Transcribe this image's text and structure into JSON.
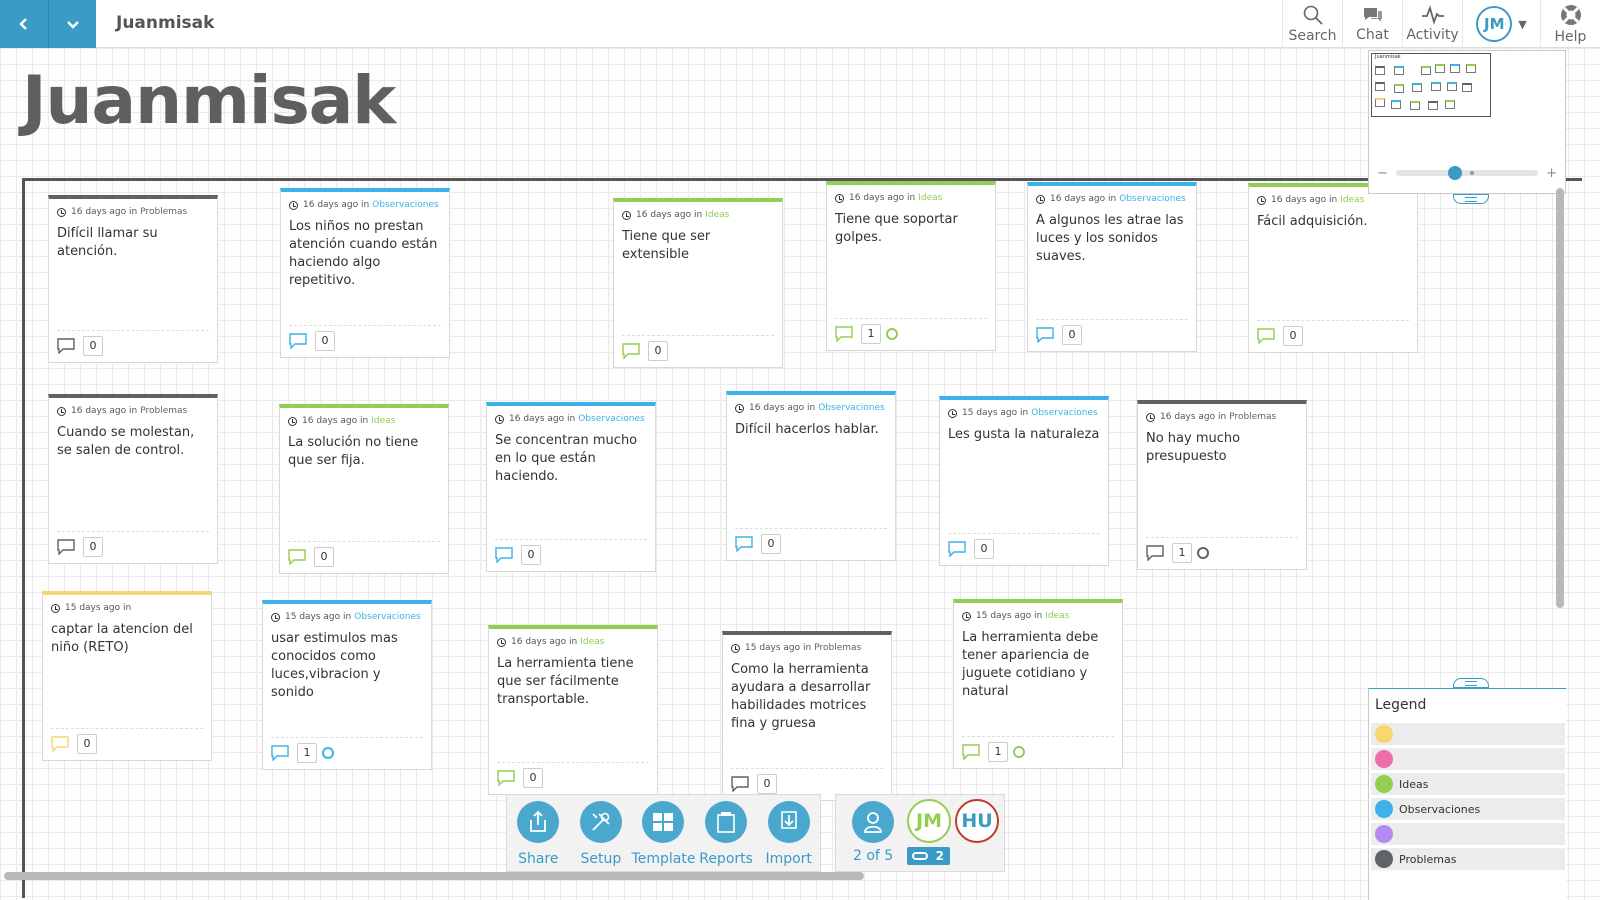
{
  "app": {
    "title": "Juanmisak"
  },
  "board": {
    "title": "Juanmisak"
  },
  "header": {
    "actions": [
      {
        "id": "search",
        "label": "Search",
        "icon": "search-icon"
      },
      {
        "id": "chat",
        "label": "Chat",
        "icon": "chat-icon"
      },
      {
        "id": "activity",
        "label": "Activity",
        "icon": "activity-icon"
      }
    ],
    "user_initials": "JM",
    "help_label": "Help"
  },
  "colors": {
    "accent": "#3a9cc4",
    "ideas": "#93cd52",
    "observaciones": "#3db2e8",
    "problemas": "#5f6368",
    "yellow": "#f5d76e",
    "pink": "#ef6ea8",
    "purple": "#b58af0"
  },
  "cards": [
    {
      "meta": "16 days ago",
      "in": "in",
      "category": "Problemas",
      "text": "Difícil llamar su atención.",
      "comments": "0",
      "color": "problemas"
    },
    {
      "meta": "16 days ago",
      "in": "in",
      "category": "Observaciones",
      "text": "Los niños no prestan atención cuando están haciendo algo repetitivo.",
      "comments": "0",
      "color": "observaciones"
    },
    {
      "meta": "16 days ago",
      "in": "in",
      "category": "Ideas",
      "text": "Tiene que ser extensible",
      "comments": "0",
      "color": "ideas"
    },
    {
      "meta": "16 days ago",
      "in": "in",
      "category": "Ideas",
      "text": "Tiene que soportar golpes.",
      "comments": "1",
      "color": "ideas",
      "vote": true
    },
    {
      "meta": "16 days ago",
      "in": "in",
      "category": "Observaciones",
      "text": "A algunos les atrae las luces y los sonidos suaves.",
      "comments": "0",
      "color": "observaciones"
    },
    {
      "meta": "16 days ago",
      "in": "in",
      "category": "Ideas",
      "text": "Fácil adquisición.",
      "comments": "0",
      "color": "ideas"
    },
    {
      "meta": "16 days ago",
      "in": "in",
      "category": "Problemas",
      "text": "Cuando se molestan, se salen de control.",
      "comments": "0",
      "color": "problemas"
    },
    {
      "meta": "16 days ago",
      "in": "in",
      "category": "Ideas",
      "text": "La solución no tiene que ser fija.",
      "comments": "0",
      "color": "ideas"
    },
    {
      "meta": "16 days ago",
      "in": "in",
      "category": "Observaciones",
      "text": "Se concentran mucho en lo que están haciendo.",
      "comments": "0",
      "color": "observaciones"
    },
    {
      "meta": "16 days ago",
      "in": "in",
      "category": "Observaciones",
      "text": "Difícil hacerlos hablar.",
      "comments": "0",
      "color": "observaciones"
    },
    {
      "meta": "15 days ago",
      "in": "in",
      "category": "Observaciones",
      "text": "Les gusta la naturaleza",
      "comments": "0",
      "color": "observaciones"
    },
    {
      "meta": "16 days ago",
      "in": "in",
      "category": "Problemas",
      "text": "No hay mucho presupuesto",
      "comments": "1",
      "color": "problemas",
      "vote": true
    },
    {
      "meta": "15 days ago",
      "in": "in",
      "category": "",
      "text": "captar la atencion del niño (RETO)",
      "comments": "0",
      "color": "yellow"
    },
    {
      "meta": "15 days ago",
      "in": "in",
      "category": "Observaciones",
      "text": "usar estimulos mas conocidos como luces,vibracion y sonido",
      "comments": "1",
      "color": "observaciones",
      "vote": true
    },
    {
      "meta": "16 days ago",
      "in": "in",
      "category": "Ideas",
      "text": "La herramienta tiene que ser fácilmente transportable.",
      "comments": "0",
      "color": "ideas"
    },
    {
      "meta": "15 days ago",
      "in": "in",
      "category": "Problemas",
      "text": "Como la herramienta ayudara a desarrollar habilidades motrices fina y gruesa",
      "comments": "0",
      "color": "problemas"
    },
    {
      "meta": "15 days ago",
      "in": "in",
      "category": "Ideas",
      "text": "La herramienta debe tener apariencia de juguete cotidiano y natural",
      "comments": "1",
      "color": "ideas",
      "vote": true
    }
  ],
  "minimap": {
    "label": "Juanmisak"
  },
  "legend": {
    "title": "Legend",
    "items": [
      {
        "label": "",
        "color": "#f5d76e"
      },
      {
        "label": "",
        "color": "#ef6ea8"
      },
      {
        "label": "Ideas",
        "color": "#93cd52"
      },
      {
        "label": "Observaciones",
        "color": "#3db2e8"
      },
      {
        "label": "",
        "color": "#b58af0"
      },
      {
        "label": "Problemas",
        "color": "#5f6368"
      }
    ]
  },
  "toolbar": {
    "share": "Share",
    "setup": "Setup",
    "template": "Template",
    "reports": "Reports",
    "import": "Import"
  },
  "people": {
    "count_label": "2 of 5",
    "users": [
      "JM",
      "HU"
    ],
    "online_count": "2"
  }
}
